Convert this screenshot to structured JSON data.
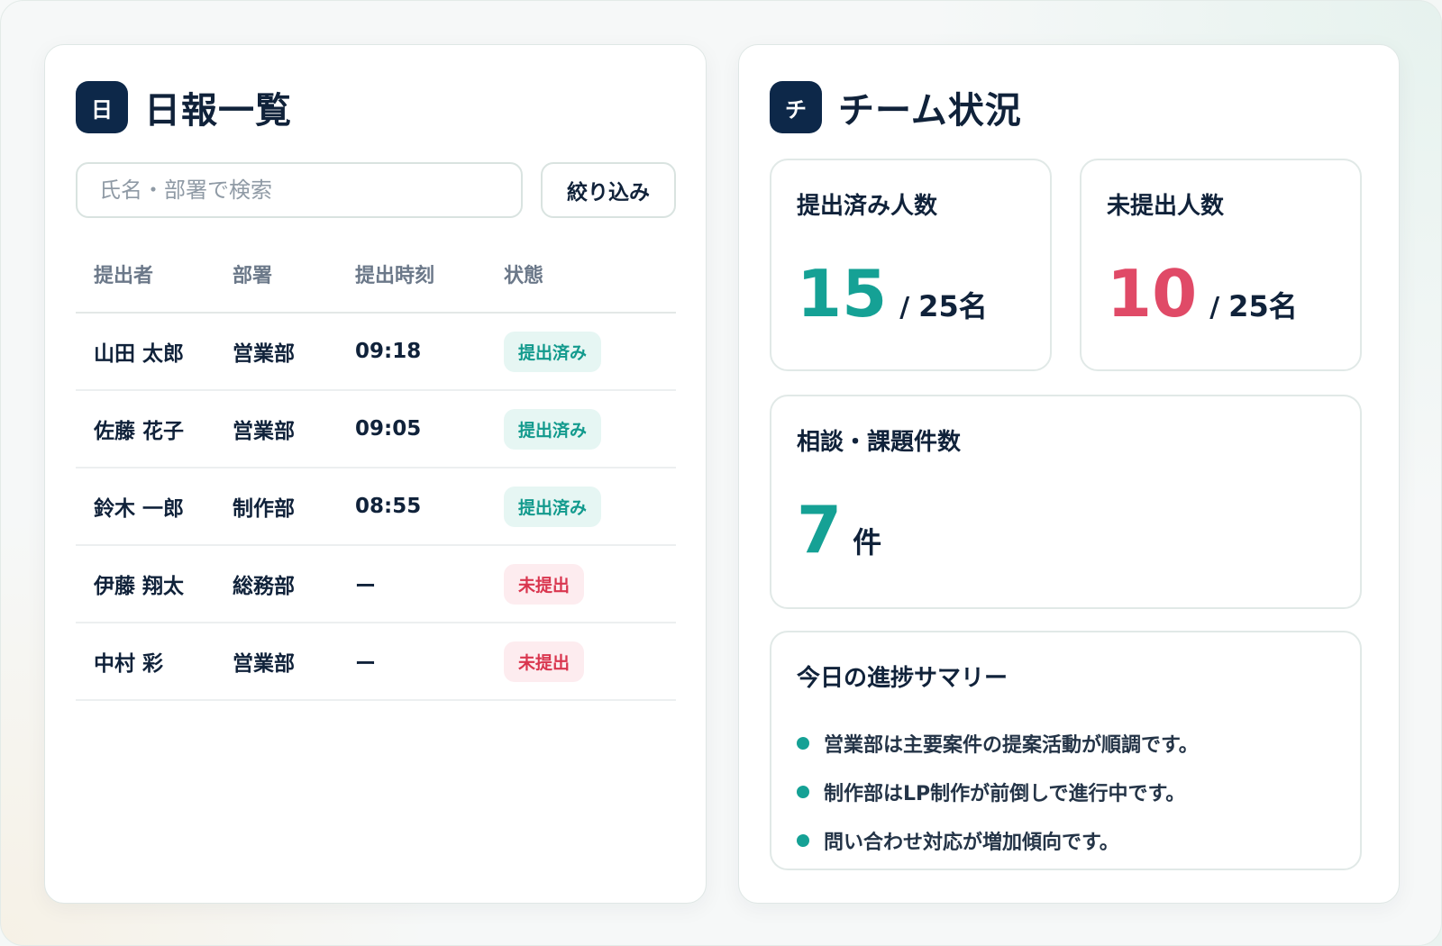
{
  "left_panel": {
    "icon_char": "日",
    "title": "日報一覧",
    "search_placeholder": "氏名・部署で検索",
    "filter_label": "絞り込み",
    "columns": [
      "提出者",
      "部署",
      "提出時刻",
      "状態"
    ],
    "rows": [
      {
        "name": "山田 太郎",
        "dept": "営業部",
        "time": "09:18",
        "status": "提出済み",
        "status_type": "ok"
      },
      {
        "name": "佐藤 花子",
        "dept": "営業部",
        "time": "09:05",
        "status": "提出済み",
        "status_type": "ok"
      },
      {
        "name": "鈴木 一郎",
        "dept": "制作部",
        "time": "08:55",
        "status": "提出済み",
        "status_type": "ok"
      },
      {
        "name": "伊藤 翔太",
        "dept": "総務部",
        "time": "ー",
        "status": "未提出",
        "status_type": "ng"
      },
      {
        "name": "中村 彩",
        "dept": "営業部",
        "time": "ー",
        "status": "未提出",
        "status_type": "ng"
      }
    ]
  },
  "right_panel": {
    "icon_char": "チ",
    "title": "チーム状況",
    "submitted": {
      "label": "提出済み人数",
      "value": "15",
      "slash": "/",
      "total": "25名"
    },
    "unsubmitted": {
      "label": "未提出人数",
      "value": "10",
      "slash": "/",
      "total": "25名"
    },
    "issues": {
      "label": "相談・課題件数",
      "value": "7",
      "unit": "件"
    },
    "summary": {
      "title": "今日の進捗サマリー",
      "items": [
        "営業部は主要案件の提案活動が順調です。",
        "制作部はLP制作が前倒しで進行中です。",
        "問い合わせ対応が増加傾向です。"
      ]
    }
  },
  "colors": {
    "navy": "#0d2849",
    "teal": "#15a195",
    "red": "#e04a67"
  }
}
